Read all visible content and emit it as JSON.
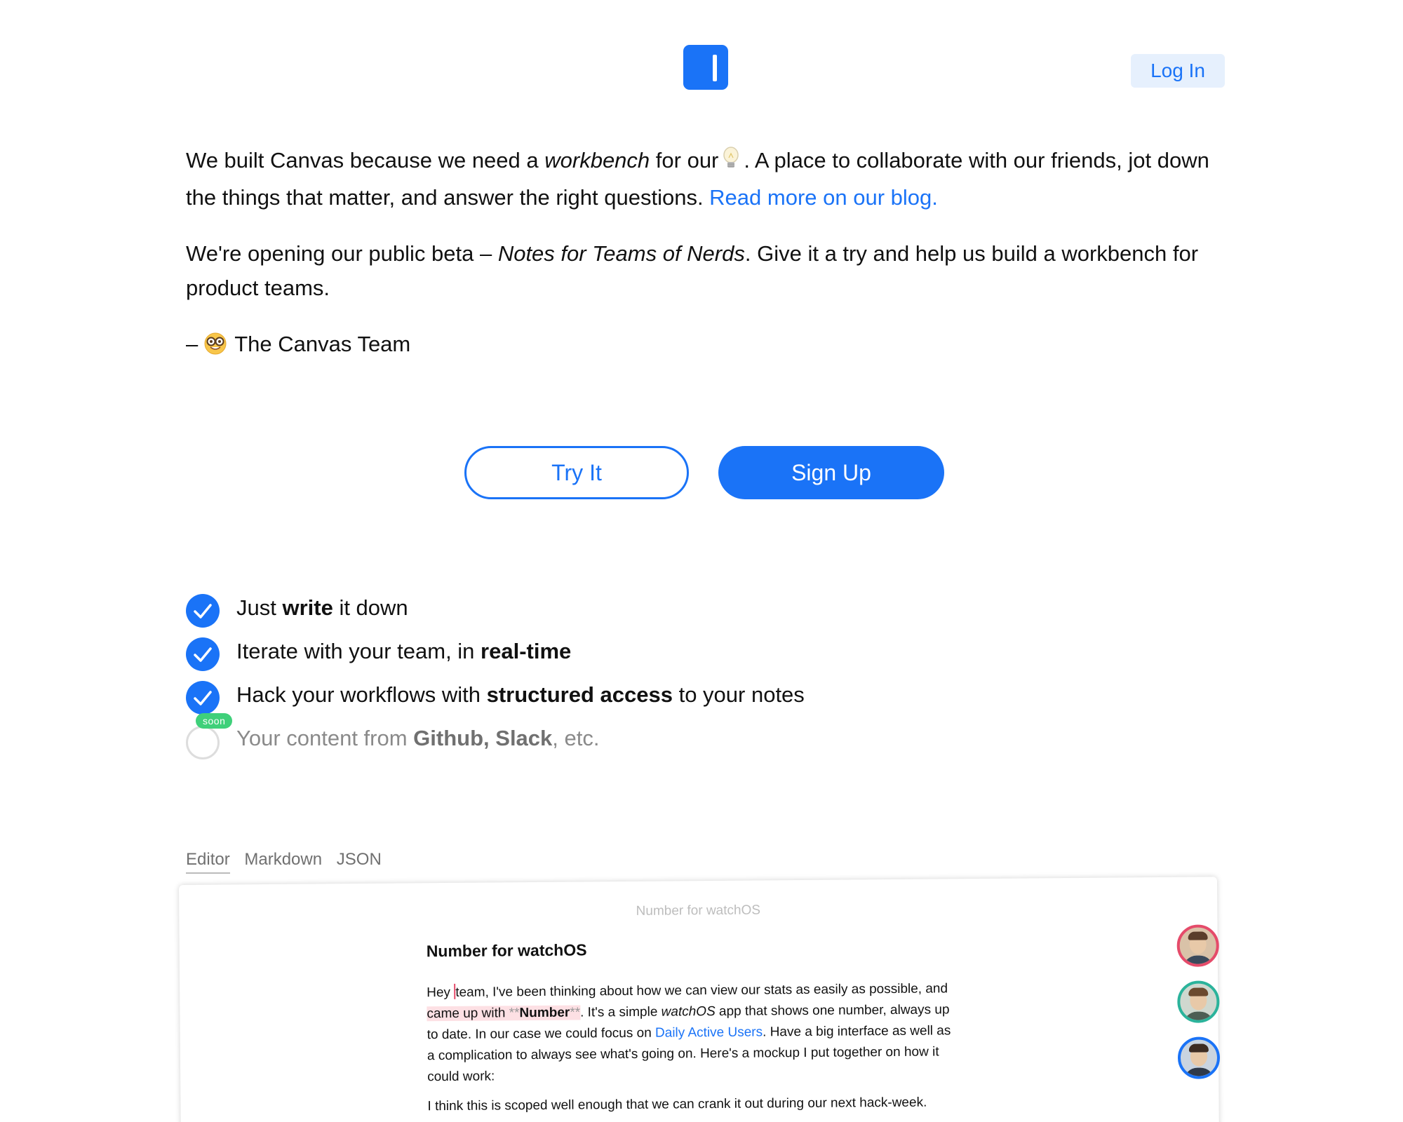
{
  "header": {
    "login_label": "Log In"
  },
  "intro": {
    "p1_a": "We built Canvas because we need a ",
    "p1_em": "workbench",
    "p1_b": " for our",
    "p1_c": ". A place to collaborate with our friends, jot down the things that matter, and answer the right questions. ",
    "p1_link": "Read more on our blog.",
    "p2_a": "We're opening our public beta – ",
    "p2_em": "Notes for Teams of Nerds",
    "p2_b": ". Give it a try and help us build a workbench for product teams.",
    "sign_dash": "–",
    "sign_name": "The Canvas Team"
  },
  "cta": {
    "try_label": "Try It",
    "signup_label": "Sign Up"
  },
  "features": [
    {
      "pre": "Just ",
      "bold": "write",
      "post": " it down",
      "checked": true
    },
    {
      "pre": "Iterate with your team, in ",
      "bold": "real-time",
      "post": "",
      "checked": true
    },
    {
      "pre": "Hack your workflows with ",
      "bold": "structured access",
      "post": " to your notes",
      "checked": true
    },
    {
      "pre": "Your content from ",
      "bold": "Github",
      "mid": ", ",
      "bold2": "Slack",
      "post": ", etc.",
      "checked": false,
      "badge": "soon"
    }
  ],
  "tabs": [
    "Editor",
    "Markdown",
    "JSON"
  ],
  "editor": {
    "window_title": "Number for watchOS",
    "doc_title": "Number for watchOS",
    "p1_a": "Hey ",
    "p1_b": "team, I've been thinking about how we can view our stats as easily as possible, and ",
    "p1_hl_a": "came up with ",
    "p1_hl_mk1": "**",
    "p1_hl_bold": "Number",
    "p1_hl_mk2": "**",
    "p1_c": ". It's a simple ",
    "p1_em": "watchOS",
    "p1_d": " app that shows one number, always up to date. In our case we could focus on ",
    "p1_link": "Daily Active Users",
    "p1_e": ". Have a big interface as well as a complication to always see what's going on. Here's a mockup I put together on how it could work:",
    "p2": "I think this is scoped well enough that we can crank it out during our next hack-week."
  },
  "colors": {
    "accent": "#1a73f7",
    "soon_badge": "#3fd07a",
    "highlight": "#fde0e4",
    "avatar_borders": [
      "#e54b6a",
      "#2bb39b",
      "#1a73f7"
    ]
  }
}
